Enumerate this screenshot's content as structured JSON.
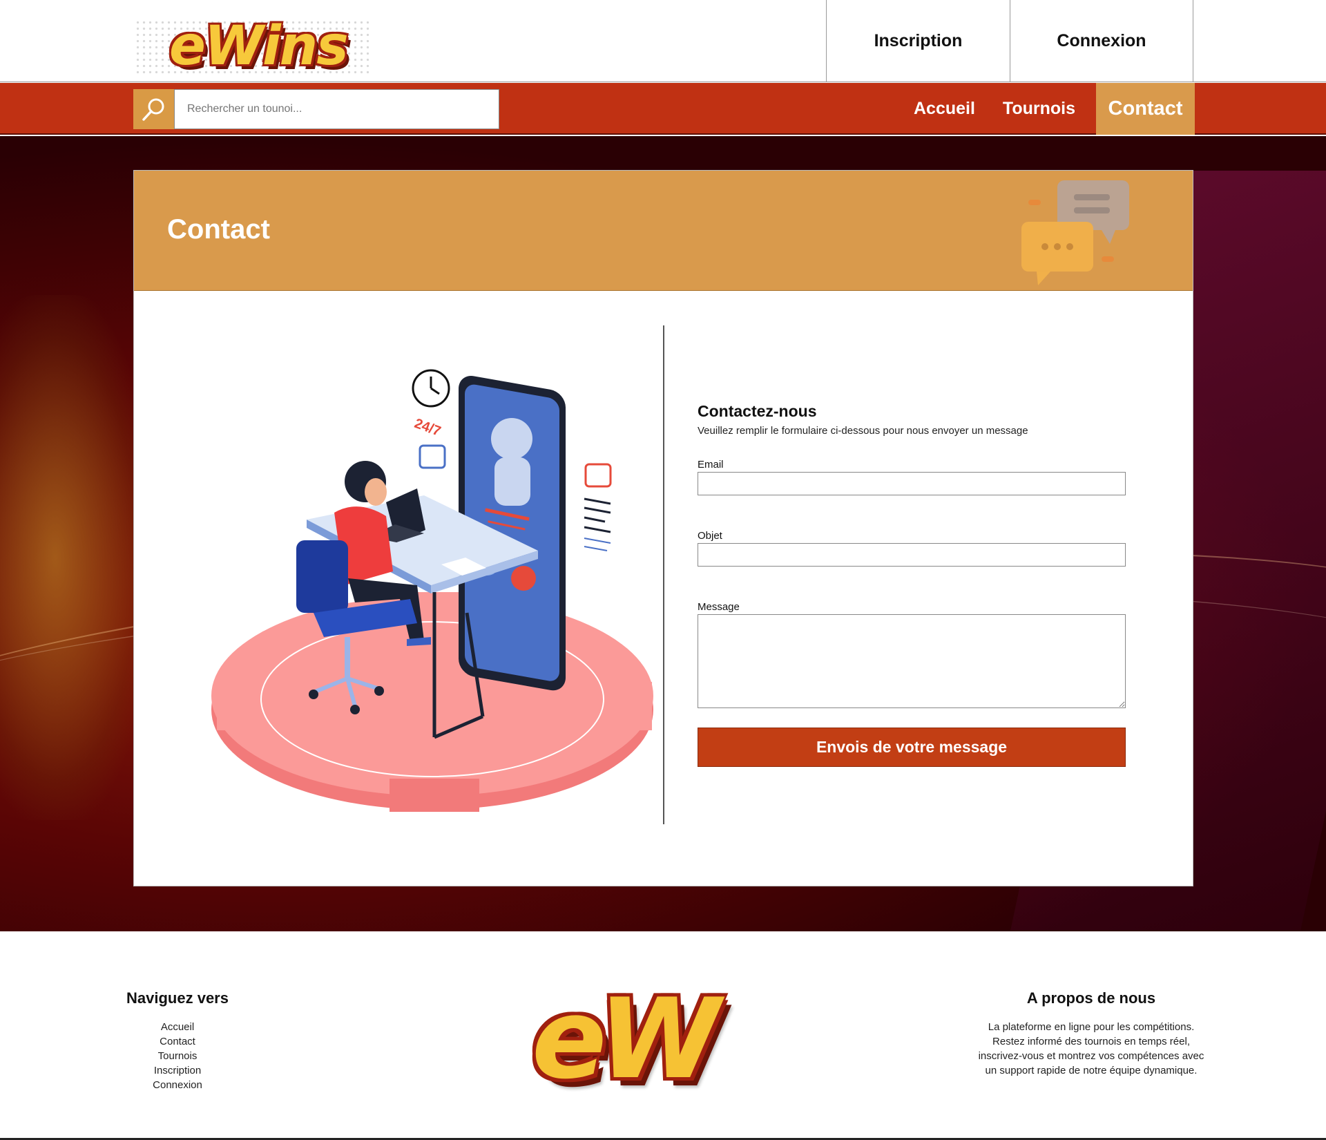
{
  "header": {
    "logo_text": "eWins",
    "links": [
      "Inscription",
      "Connexion"
    ]
  },
  "navbar": {
    "search_placeholder": "Rechercher un tounoi...",
    "links": [
      "Accueil",
      "Tournois",
      "Contact"
    ],
    "active": "Contact"
  },
  "card": {
    "title": "Contact",
    "illustration_text": "24/7"
  },
  "form": {
    "title": "Contactez-nous",
    "subtitle": "Veuillez remplir le formulaire ci-dessous pour nous envoyer un message",
    "email_label": "Email",
    "email_value": "",
    "subject_label": "Objet",
    "subject_value": "",
    "message_label": "Message",
    "message_value": "",
    "submit_label": "Envois de votre message"
  },
  "footer": {
    "nav_title": "Naviguez vers",
    "nav_links": [
      "Accueil",
      "Contact",
      "Tournois",
      "Inscription",
      "Connexion"
    ],
    "logo_text": "eW",
    "about_title": "A propos de nous",
    "about_lines": [
      "La plateforme en ligne pour les compétitions.",
      "Restez informé des tournois en temps réel,",
      "inscrivez-vous et montrez vos compétences avec",
      "un support rapide de notre équipe dynamique."
    ]
  },
  "colors": {
    "nav_red": "#c03113",
    "accent_orange": "#d99a4c",
    "button_red": "#c23e14"
  }
}
